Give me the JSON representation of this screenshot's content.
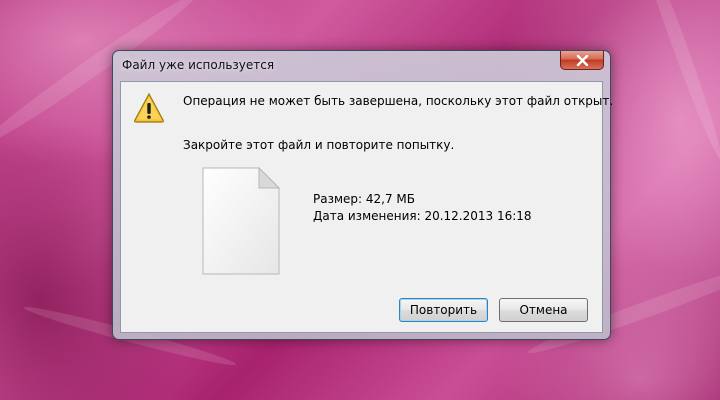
{
  "dialog": {
    "title": "Файл уже используется",
    "main_message": "Операция не может быть завершена, поскольку этот файл открыт.",
    "sub_message": "Закройте этот файл и повторите попытку.",
    "file_size": "Размер: 42,7 МБ",
    "file_modified": "Дата изменения: 20.12.2013 16:18",
    "retry_label": "Повторить",
    "cancel_label": "Отмена"
  },
  "icons": {
    "close": "close-icon",
    "warning": "warning-icon",
    "file": "file-icon"
  },
  "colors": {
    "close_button": "#c13a22",
    "warning_triangle": "#f2c230",
    "default_button_border": "#3c7fb1",
    "client_background": "#f0f0f0"
  }
}
